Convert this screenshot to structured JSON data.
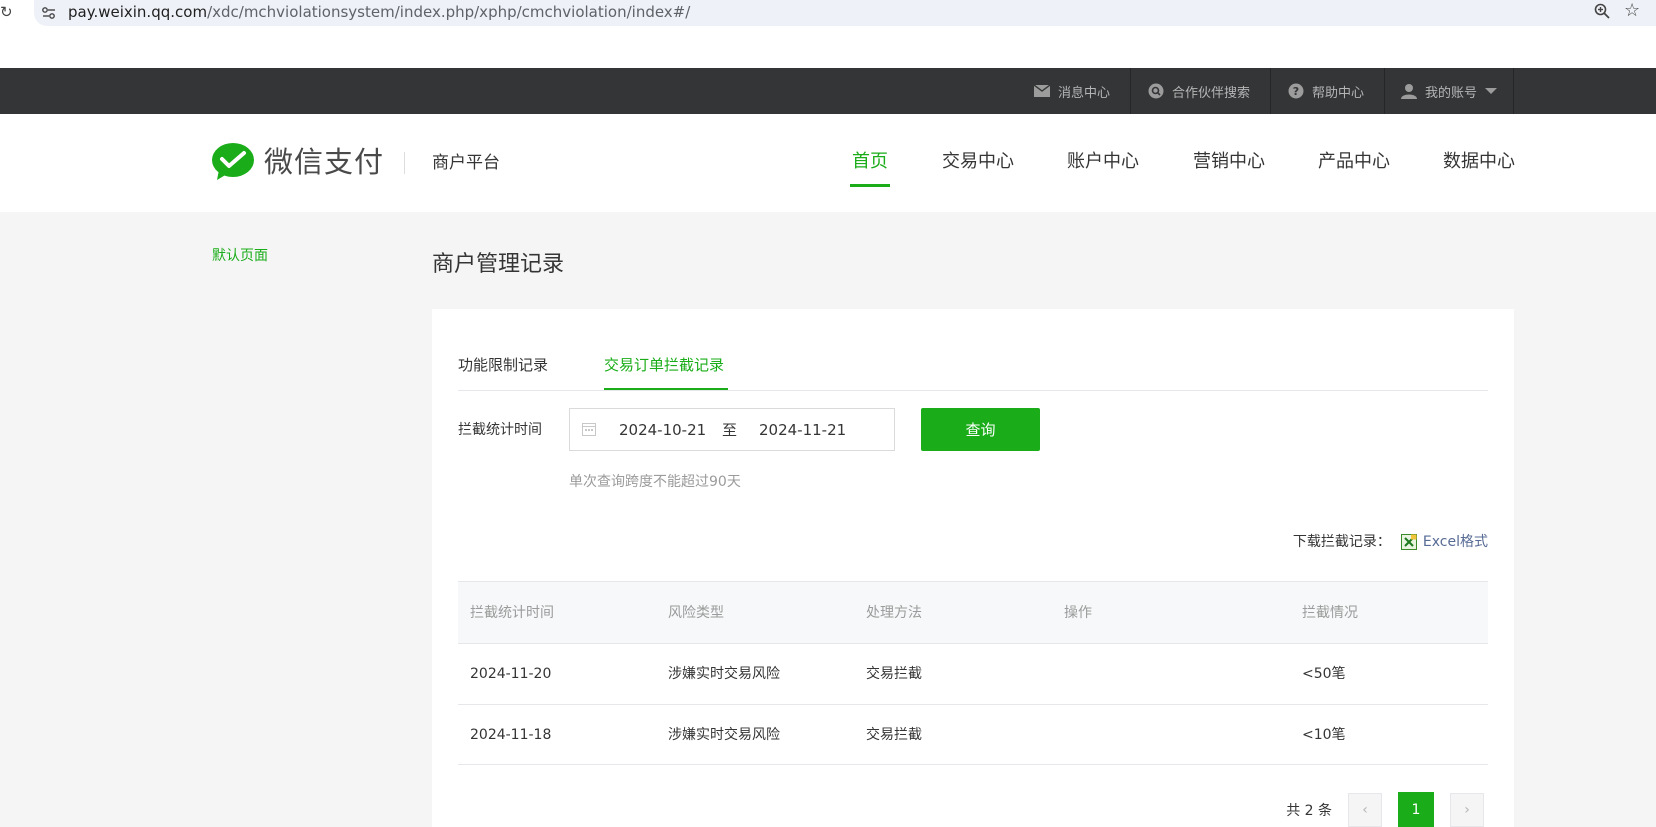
{
  "browser": {
    "url_host": "pay.weixin.qq.com",
    "url_path": "/xdc/mchviolationsystem/index.php/xphp/cmchviolation/index#/"
  },
  "topbar": {
    "messages": "消息中心",
    "partner_search": "合作伙伴搜索",
    "help": "帮助中心",
    "account": "我的账号"
  },
  "header": {
    "brand": "微信支付",
    "platform": "商户平台",
    "nav": [
      "首页",
      "交易中心",
      "账户中心",
      "营销中心",
      "产品中心",
      "数据中心"
    ],
    "active_nav": "首页"
  },
  "sidebar": {
    "default_page": "默认页面"
  },
  "main": {
    "title": "商户管理记录",
    "tabs": [
      "功能限制记录",
      "交易订单拦截记录"
    ],
    "active_tab": "交易订单拦截记录",
    "filter": {
      "label": "拦截统计时间",
      "start_date": "2024-10-21",
      "to": "至",
      "end_date": "2024-11-21",
      "query_button": "查询",
      "hint": "单次查询跨度不能超过90天"
    },
    "download": {
      "label": "下载拦截记录：",
      "excel": "Excel格式"
    },
    "table": {
      "headers": [
        "拦截统计时间",
        "风险类型",
        "处理方法",
        "操作",
        "拦截情况"
      ],
      "rows": [
        [
          "2024-11-20",
          "涉嫌实时交易风险",
          "交易拦截",
          "",
          "<50笔"
        ],
        [
          "2024-11-18",
          "涉嫌实时交易风险",
          "交易拦截",
          "",
          "<10笔"
        ]
      ]
    },
    "pagination": {
      "total": "共 2 条",
      "current_page": "1"
    }
  },
  "colors": {
    "accent": "#1aad19",
    "topbar": "#333537",
    "link": "#576b95"
  }
}
